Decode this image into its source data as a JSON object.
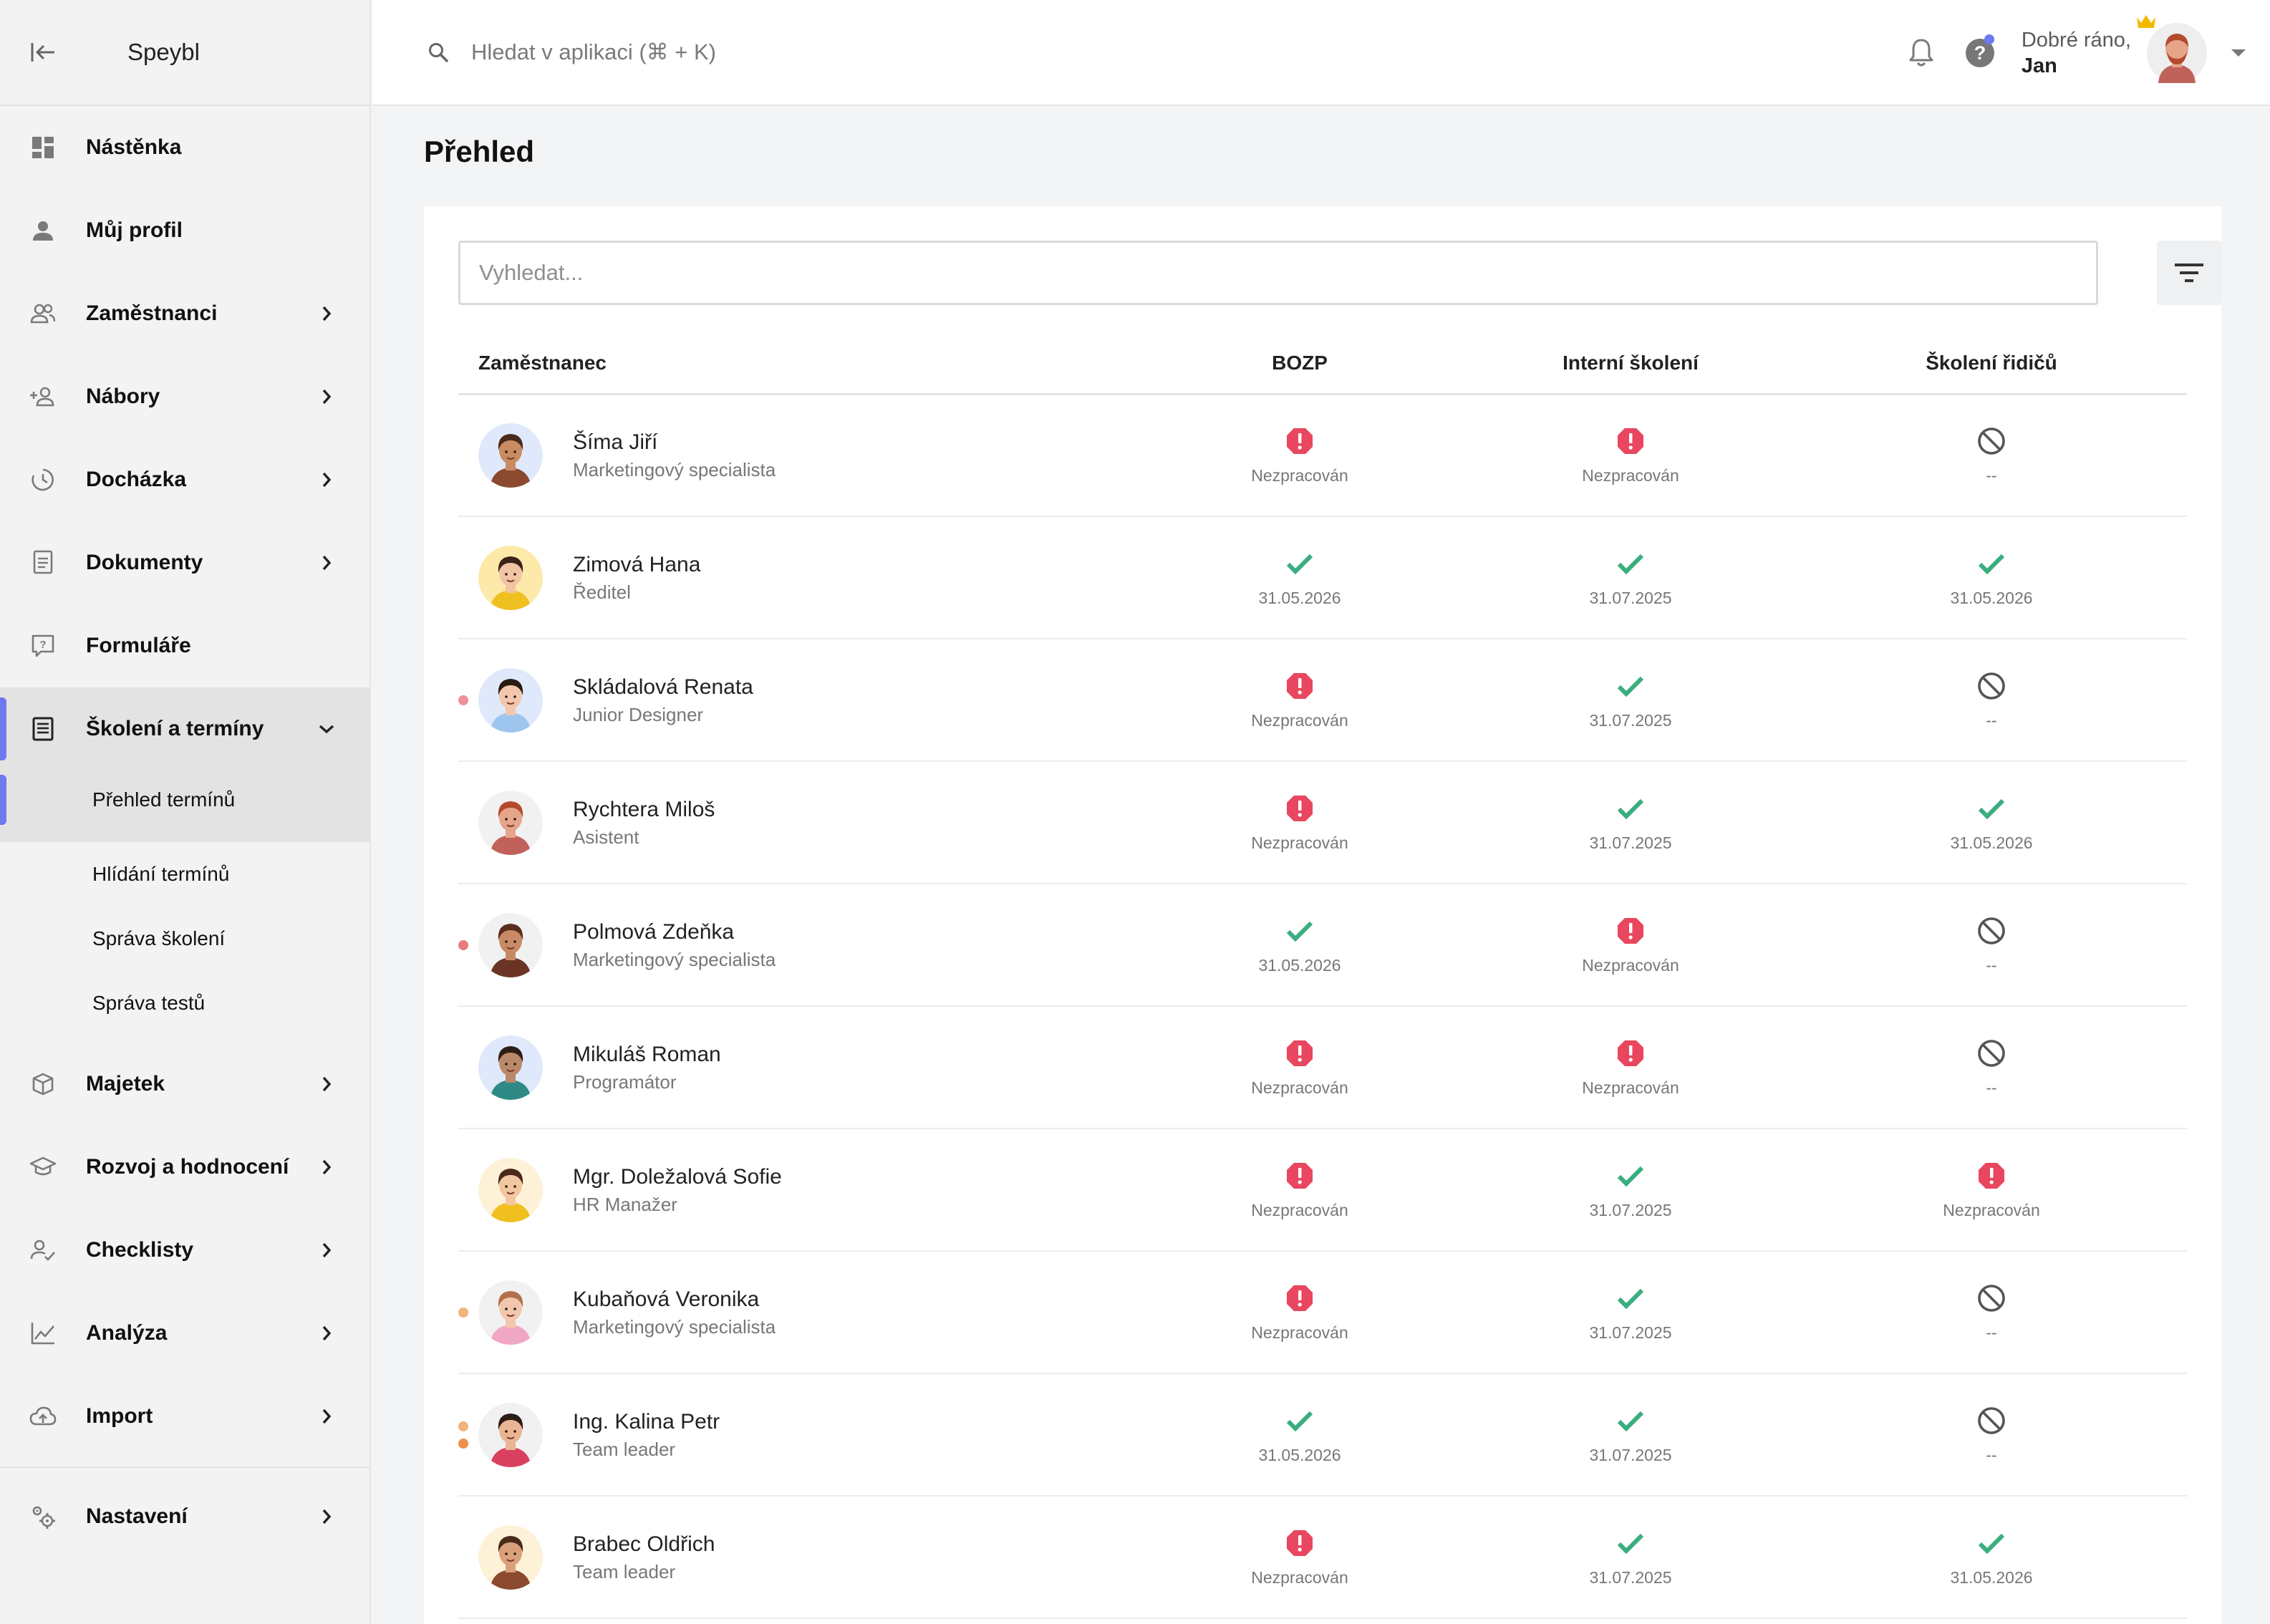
{
  "app": {
    "brand": "Speybl"
  },
  "topbar": {
    "search_placeholder": "Hledat v aplikaci (⌘ + K)",
    "greeting": "Dobré ráno,",
    "user_name": "Jan"
  },
  "sidebar": {
    "items": [
      {
        "label": "Nástěnka",
        "icon": "dashboard-icon",
        "has_chevron": false
      },
      {
        "label": "Můj profil",
        "icon": "person-icon",
        "has_chevron": false
      },
      {
        "label": "Zaměstnanci",
        "icon": "people-icon",
        "has_chevron": true
      },
      {
        "label": "Nábory",
        "icon": "person-add-icon",
        "has_chevron": true
      },
      {
        "label": "Docházka",
        "icon": "clock-icon",
        "has_chevron": true
      },
      {
        "label": "Dokumenty",
        "icon": "document-icon",
        "has_chevron": true
      },
      {
        "label": "Formuláře",
        "icon": "form-icon",
        "has_chevron": false
      },
      {
        "label": "Školení a termíny",
        "icon": "training-icon",
        "has_chevron": true,
        "active": true
      }
    ],
    "subitems": [
      {
        "label": "Přehled termínů",
        "active": true
      },
      {
        "label": "Hlídání termínů"
      },
      {
        "label": "Správa školení"
      },
      {
        "label": "Správa testů"
      }
    ],
    "items2": [
      {
        "label": "Majetek",
        "icon": "box-icon"
      },
      {
        "label": "Rozvoj a hodnocení",
        "icon": "graduation-icon"
      },
      {
        "label": "Checklisty",
        "icon": "checklist-icon"
      },
      {
        "label": "Analýza",
        "icon": "chart-icon"
      },
      {
        "label": "Import",
        "icon": "cloud-upload-icon"
      }
    ],
    "settings": {
      "label": "Nastavení",
      "icon": "settings-icon"
    }
  },
  "main": {
    "title": "Přehled",
    "search_placeholder": "Vyhledat...",
    "columns": [
      "Zaměstnanec",
      "BOZP",
      "Interní školení",
      "Školení řidičů"
    ]
  },
  "colors": {
    "accent": "#6d79f0",
    "ok": "#3aae7e",
    "error": "#e8475f",
    "muted": "#555555",
    "dot_pink": "#ef8f9b",
    "dot_salmon": "#e87b7b",
    "dot_peach": "#f2b27b",
    "dot_orange": "#ef8f4e"
  },
  "rows": [
    {
      "name": "Šíma Jiří",
      "role": "Marketingový specialista",
      "dots": [],
      "avatar_bg": "#dfe9fb",
      "skin": "#c98b62",
      "hair": "#4a2a1a",
      "shirt": "#8b4a2f",
      "cells": [
        {
          "status": "error",
          "text": "Nezpracován"
        },
        {
          "status": "error",
          "text": "Nezpracován"
        },
        {
          "status": "na",
          "text": "--"
        }
      ]
    },
    {
      "name": "Zimová Hana",
      "role": "Ředitel",
      "dots": [],
      "avatar_bg": "#fde9a9",
      "skin": "#f0c4a4",
      "hair": "#3a2418",
      "shirt": "#f0c020",
      "cells": [
        {
          "status": "ok",
          "text": "31.05.2026"
        },
        {
          "status": "ok",
          "text": "31.07.2025"
        },
        {
          "status": "ok",
          "text": "31.05.2026"
        }
      ]
    },
    {
      "name": "Skládalová Renata",
      "role": "Junior Designer",
      "dots": [
        "#ef8f9b"
      ],
      "avatar_bg": "#dfe9fb",
      "skin": "#f2c7ad",
      "hair": "#2a1a14",
      "shirt": "#9dc5ee",
      "cells": [
        {
          "status": "error",
          "text": "Nezpracován"
        },
        {
          "status": "ok",
          "text": "31.07.2025"
        },
        {
          "status": "na",
          "text": "--"
        }
      ]
    },
    {
      "name": "Rychtera Miloš",
      "role": "Asistent",
      "dots": [],
      "avatar_bg": "#f1f1f1",
      "skin": "#e6a48a",
      "hair": "#b34a2e",
      "shirt": "#c0625a",
      "cells": [
        {
          "status": "error",
          "text": "Nezpracován"
        },
        {
          "status": "ok",
          "text": "31.07.2025"
        },
        {
          "status": "ok",
          "text": "31.05.2026"
        }
      ]
    },
    {
      "name": "Polmová Zdeňka",
      "role": "Marketingový specialista",
      "dots": [
        "#e87b7b"
      ],
      "avatar_bg": "#f1f1f1",
      "skin": "#c88a66",
      "hair": "#5a2e1e",
      "shirt": "#6a3424",
      "cells": [
        {
          "status": "ok",
          "text": "31.05.2026"
        },
        {
          "status": "error",
          "text": "Nezpracován"
        },
        {
          "status": "na",
          "text": "--"
        }
      ]
    },
    {
      "name": "Mikuláš Roman",
      "role": "Programátor",
      "dots": [],
      "avatar_bg": "#dfe9fb",
      "skin": "#b9896a",
      "hair": "#2c1d16",
      "shirt": "#2f8a86",
      "cells": [
        {
          "status": "error",
          "text": "Nezpracován"
        },
        {
          "status": "error",
          "text": "Nezpracován"
        },
        {
          "status": "na",
          "text": "--"
        }
      ]
    },
    {
      "name": "Mgr. Doležalová Sofie",
      "role": "HR Manažer",
      "dots": [],
      "avatar_bg": "#fdf2d8",
      "skin": "#f2c7a0",
      "hair": "#4a2a1a",
      "shirt": "#f0c020",
      "cells": [
        {
          "status": "error",
          "text": "Nezpracován"
        },
        {
          "status": "ok",
          "text": "31.07.2025"
        },
        {
          "status": "error",
          "text": "Nezpracován"
        }
      ]
    },
    {
      "name": "Kubaňová Veronika",
      "role": "Marketingový specialista",
      "dots": [
        "#f2b27b"
      ],
      "avatar_bg": "#f1f1f1",
      "skin": "#f2c7ad",
      "hair": "#b0704a",
      "shirt": "#f0a7c4",
      "cells": [
        {
          "status": "error",
          "text": "Nezpracován"
        },
        {
          "status": "ok",
          "text": "31.07.2025"
        },
        {
          "status": "na",
          "text": "--"
        }
      ]
    },
    {
      "name": "Ing. Kalina Petr",
      "role": "Team leader",
      "dots": [
        "#f2b27b",
        "#ef8f4e"
      ],
      "avatar_bg": "#f1f1f1",
      "skin": "#e9b594",
      "hair": "#2c1d16",
      "shirt": "#d94060",
      "cells": [
        {
          "status": "ok",
          "text": "31.05.2026"
        },
        {
          "status": "ok",
          "text": "31.07.2025"
        },
        {
          "status": "na",
          "text": "--"
        }
      ]
    },
    {
      "name": "Brabec Oldřich",
      "role": "Team leader",
      "dots": [],
      "avatar_bg": "#fdf2d8",
      "skin": "#d9a07a",
      "hair": "#4a2a1a",
      "shirt": "#8b4a2f",
      "cells": [
        {
          "status": "error",
          "text": "Nezpracován"
        },
        {
          "status": "ok",
          "text": "31.07.2025"
        },
        {
          "status": "ok",
          "text": "31.05.2026"
        }
      ]
    }
  ]
}
